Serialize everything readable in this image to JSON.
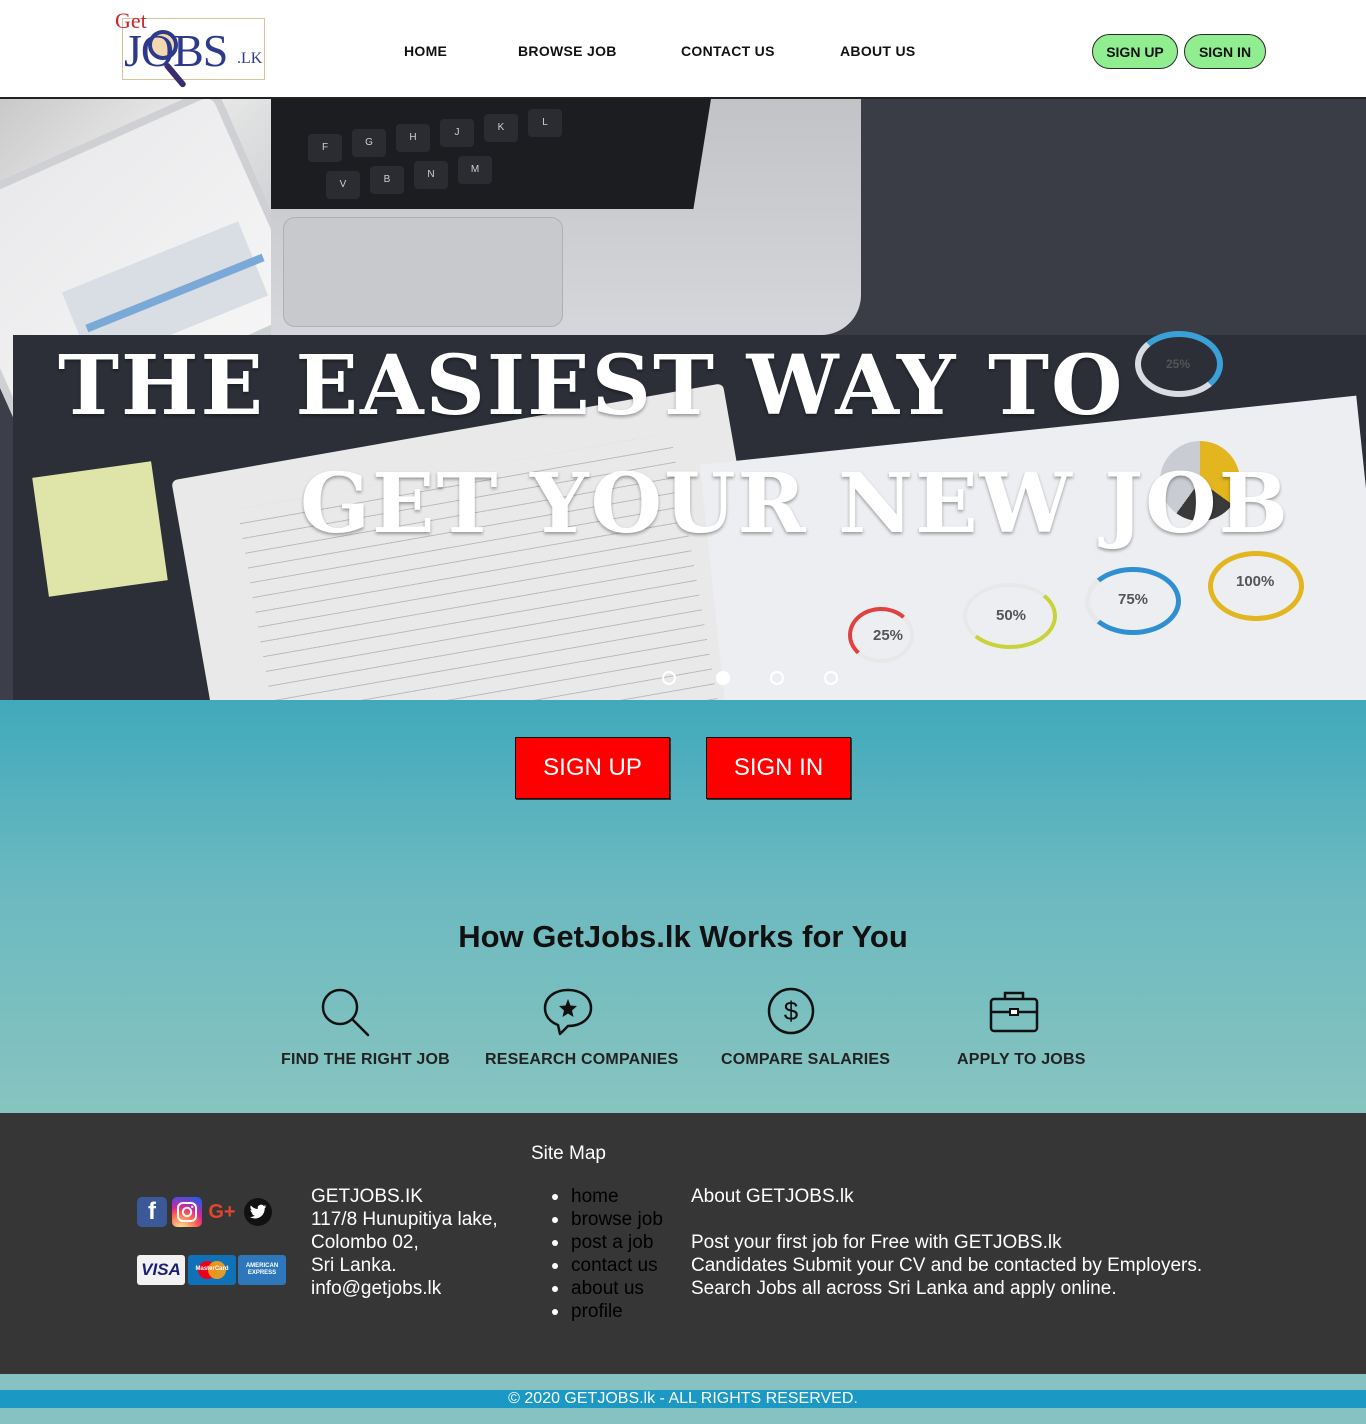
{
  "header": {
    "logo": {
      "get": "Get",
      "jobs": "JOBS",
      "lk": ".LK"
    },
    "nav": [
      "HOME",
      "BROWSE JOB",
      "CONTACT US",
      "ABOUT US"
    ],
    "signup": "SIGN UP",
    "signin": "SIGN IN",
    "colors": {
      "pill": "#90ee90"
    }
  },
  "hero": {
    "line1": "THE EASIEST WAY TO",
    "line2": "GET YOUR NEW JOB",
    "keys": [
      "F",
      "G",
      "H",
      "J",
      "K",
      "L",
      "V",
      "B",
      "N",
      "M"
    ],
    "chart_labels": [
      "25%",
      "50%",
      "75%",
      "100%",
      "25%"
    ],
    "carousel": {
      "slides": 4,
      "active_index": 1
    }
  },
  "cta": {
    "signup": "SIGN UP",
    "signin": "SIGN IN",
    "color": "#ff0000"
  },
  "how": {
    "title": "How GetJobs.lk Works for You",
    "features": [
      {
        "icon": "search-icon",
        "label": "FIND THE RIGHT JOB"
      },
      {
        "icon": "chat-star-icon",
        "label": "RESEARCH COMPANIES"
      },
      {
        "icon": "dollar-icon",
        "label": "COMPARE SALARIES"
      },
      {
        "icon": "briefcase-icon",
        "label": "APPLY TO JOBS"
      }
    ]
  },
  "footer": {
    "sitemap_title": "Site Map",
    "address": [
      "GETJOBS.IK",
      "117/8 Hunupitiya lake,",
      "Colombo 02,",
      "Sri Lanka.",
      "info@getjobs.lk"
    ],
    "sitemap": [
      "home",
      "browse job",
      "post a job",
      "contact us",
      "about us",
      "profile"
    ],
    "about": {
      "title": "About GETJOBS.lk",
      "lines": [
        "Post your first job for Free with GETJOBS.lk",
        "Candidates Submit your CV and be contacted by Employers.",
        "Search Jobs all across Sri Lanka and apply online."
      ]
    },
    "social": [
      "facebook-icon",
      "instagram-icon",
      "google-plus-icon",
      "twitter-icon"
    ],
    "cards": [
      "VISA",
      "MasterCard",
      "AMERICAN EXPRESS"
    ],
    "copyright": "© 2020 GETJOBS.lk - ALL RIGHTS RESERVED."
  }
}
